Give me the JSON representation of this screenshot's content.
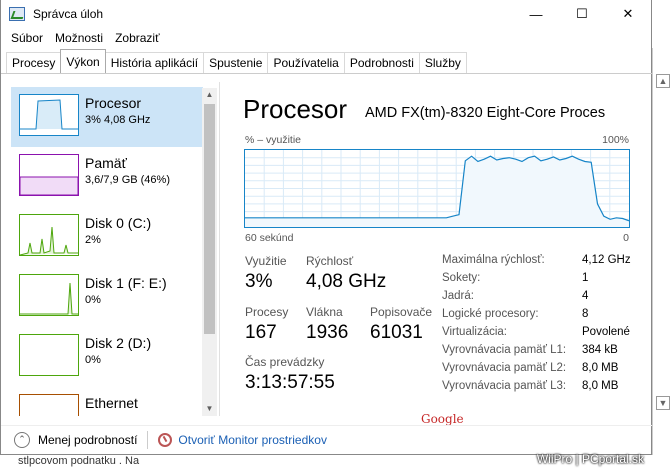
{
  "window": {
    "title": "Správca úloh"
  },
  "menu": [
    "Súbor",
    "Možnosti",
    "Zobraziť"
  ],
  "tabs": [
    "Procesy",
    "Výkon",
    "História aplikácií",
    "Spustenie",
    "Používatelia",
    "Podrobnosti",
    "Služby"
  ],
  "active_tab": "Výkon",
  "sidebar": {
    "items": [
      {
        "name": "Procesor",
        "sub": "3% 4,08 GHz",
        "color": "#1785c8"
      },
      {
        "name": "Pamäť",
        "sub": "3,6/7,9 GB (46%)",
        "color": "#8b12ae"
      },
      {
        "name": "Disk 0 (C:)",
        "sub": "2%",
        "color": "#4da60c"
      },
      {
        "name": "Disk 1 (F: E:)",
        "sub": "0%",
        "color": "#4da60c"
      },
      {
        "name": "Disk 2 (D:)",
        "sub": "0%",
        "color": "#4da60c"
      },
      {
        "name": "Ethernet",
        "sub": "",
        "color": "#a74f01"
      }
    ]
  },
  "main": {
    "title": "Procesor",
    "cpu_model": "AMD FX(tm)-8320 Eight-Core Proces",
    "graph": {
      "y_label": "% – využitie",
      "y_max_label": "100%",
      "x_label": "60 sekúnd",
      "x_end_label": "0",
      "usage_percent_series": [
        12,
        12,
        12,
        12,
        12,
        12,
        12,
        12,
        12,
        12,
        12,
        12,
        12,
        12,
        12,
        12,
        12,
        12,
        12,
        12,
        12,
        12,
        12,
        12,
        12,
        12,
        12,
        12,
        12,
        12,
        12,
        12,
        12,
        14,
        16,
        86,
        92,
        85,
        88,
        92,
        87,
        89,
        90,
        88,
        85,
        90,
        92,
        86,
        88,
        91,
        87,
        89,
        92,
        88,
        85,
        84,
        30,
        14,
        10,
        12,
        11,
        8
      ]
    },
    "stats": {
      "utilization_label": "Využitie",
      "utilization": "3%",
      "speed_label": "Rýchlosť",
      "speed": "4,08 GHz",
      "processes_label": "Procesy",
      "processes": "167",
      "threads_label": "Vlákna",
      "threads": "1936",
      "handles_label": "Popisovače",
      "handles": "61031",
      "uptime_label": "Čas prevádzky",
      "uptime": "3:13:57:55"
    },
    "specs": [
      {
        "k": "Maximálna rýchlosť:",
        "v": "4,12 GHz"
      },
      {
        "k": "Sokety:",
        "v": "1"
      },
      {
        "k": "Jadrá:",
        "v": "4"
      },
      {
        "k": "Logické procesory:",
        "v": "8"
      },
      {
        "k": "Virtualizácia:",
        "v": "Povolené"
      },
      {
        "k": "Vyrovnávacia pamäť L1:",
        "v": "384 kB"
      },
      {
        "k": "Vyrovnávacia pamäť L2:",
        "v": "8,0 MB"
      },
      {
        "k": "Vyrovnávacia pamäť L3:",
        "v": "8,0 MB"
      }
    ],
    "google": "Google"
  },
  "footer": {
    "fewer_details": "Menej podrobností",
    "open_monitor": "Otvoriť Monitor prostriedkov"
  },
  "background": {
    "bottom_text": "stĺpcovom podnatku . Na",
    "watermark": "WiiPro | PCportal.sk"
  }
}
